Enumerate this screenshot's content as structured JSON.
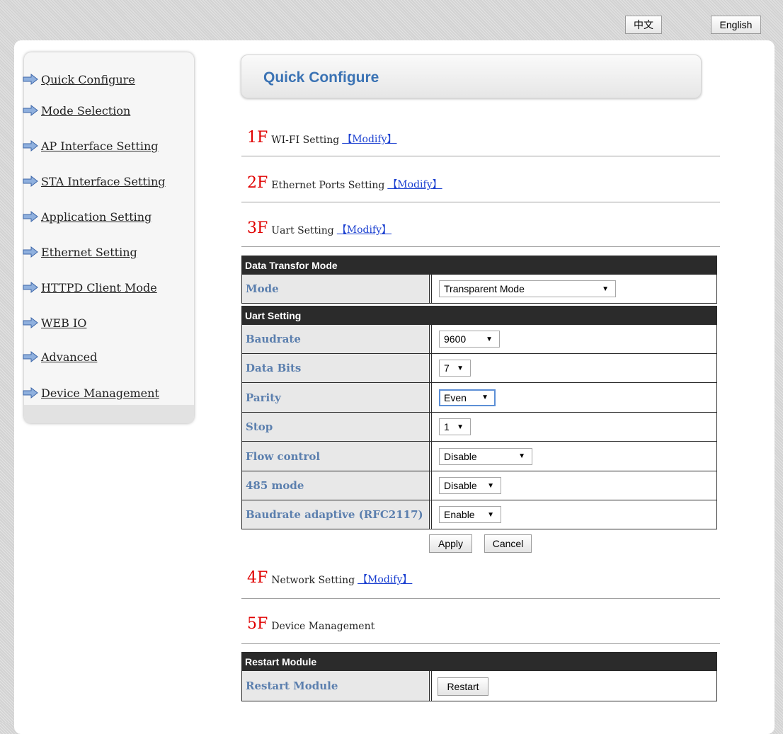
{
  "header": {
    "lang_zh": "中文",
    "lang_en": "English"
  },
  "sidebar": {
    "items": [
      {
        "label": "Quick Configure"
      },
      {
        "label": "Mode Selection"
      },
      {
        "label": "AP Interface Setting"
      },
      {
        "label": "STA Interface Setting"
      },
      {
        "label": "Application Setting"
      },
      {
        "label": "Ethernet Setting"
      },
      {
        "label": "HTTPD Client Mode"
      },
      {
        "label": "WEB IO"
      },
      {
        "label": "Advanced"
      },
      {
        "label": "Device Management"
      }
    ]
  },
  "main": {
    "title": "Quick Configure",
    "sections": [
      {
        "floor": "1F",
        "label": "WI-FI Setting",
        "modify": "【Modify】"
      },
      {
        "floor": "2F",
        "label": "Ethernet Ports Setting",
        "modify": "【Modify】"
      },
      {
        "floor": "3F",
        "label": "Uart Setting",
        "modify": "【Modify】"
      },
      {
        "floor": "4F",
        "label": "Network Setting",
        "modify": "【Modify】"
      },
      {
        "floor": "5F",
        "label": "Device Management"
      }
    ],
    "uart": {
      "data_transfer_header": "Data Transfor Mode",
      "mode_label": "Mode",
      "mode_value": "Transparent Mode",
      "uart_header": "Uart Setting",
      "baudrate_label": "Baudrate",
      "baudrate_value": "9600",
      "databits_label": "Data Bits",
      "databits_value": "7",
      "parity_label": "Parity",
      "parity_value": "Even",
      "stop_label": "Stop",
      "stop_value": "1",
      "flow_label": "Flow control",
      "flow_value": "Disable",
      "mode485_label": "485 mode",
      "mode485_value": "Disable",
      "adaptive_label": "Baudrate adaptive (RFC2117)",
      "adaptive_value": "Enable",
      "apply": "Apply",
      "cancel": "Cancel"
    },
    "restart": {
      "header": "Restart Module",
      "label": "Restart Module",
      "button": "Restart"
    }
  },
  "icons": {
    "nav_arrow": "arrow-right-icon",
    "select_arrow": "triangle-down-icon"
  },
  "colors": {
    "floor_red": "#e00000",
    "title_blue": "#3b73b4",
    "label_blue": "#5b7fae",
    "link_blue": "#1a3fd0",
    "header_dark": "#2b2b2b"
  }
}
